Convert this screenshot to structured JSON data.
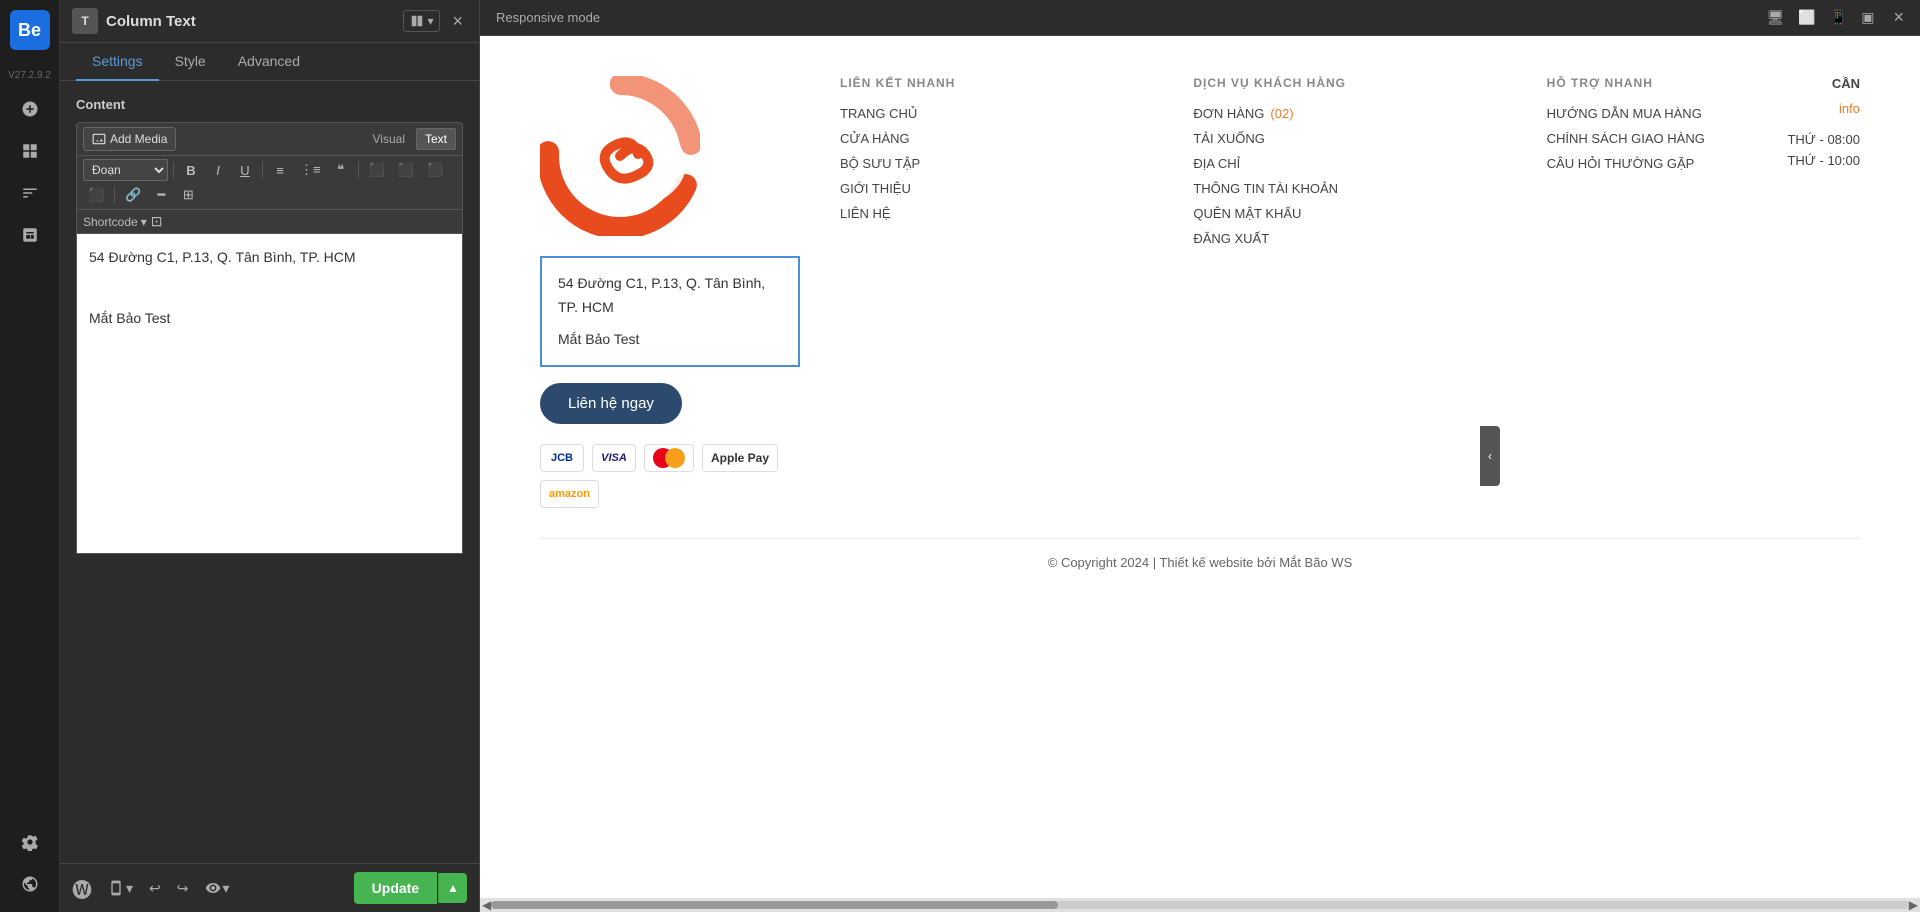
{
  "app": {
    "logo": "Be",
    "version": "V27.2.9.2"
  },
  "topbar": {
    "responsive_mode_label": "Responsive mode",
    "close_icon": "×"
  },
  "panel": {
    "title": "Column Text",
    "title_icon": "T",
    "tabs": [
      "Settings",
      "Style",
      "Advanced"
    ],
    "active_tab": "Settings",
    "section_label": "Content",
    "add_media_label": "Add Media",
    "visual_label": "Visual",
    "text_label": "Text",
    "format_options": [
      "Đoạn"
    ],
    "shortcode_label": "Shortcode",
    "editor_lines": [
      "54 Đường C1, P.13, Q. Tân Bình, TP. HCM",
      "",
      "Mắt Bảo Test"
    ]
  },
  "bottom_bar": {
    "update_label": "Update",
    "responsive_icon": "📱",
    "undo_icon": "↩",
    "redo_icon": "↪",
    "preview_icon": "👁"
  },
  "preview": {
    "logo_alt": "Mắt Bảo logo",
    "address_line1": "54 Đường C1, P.13, Q. Tân Bình,",
    "address_line2": "TP. HCM",
    "address_line3": "",
    "address_line4": "Mắt Bảo Test",
    "contact_button": "Liên hệ ngay",
    "payment_methods": [
      "JCB",
      "VISA",
      "MC",
      "Apple Pay",
      "amazon"
    ],
    "footer_nav": {
      "quick_links_title": "LIÊN KẾT NHANH",
      "quick_links": [
        "TRANG CHỦ",
        "CỬA HÀNG",
        "BỘ SƯU TẬP",
        "GIỚI THIỆU",
        "LIÊN HỆ"
      ],
      "customer_service_title": "DỊCH VỤ KHÁCH HÀNG",
      "customer_service": [
        {
          "label": "ĐƠN HÀNG",
          "badge": "(02)",
          "orange": true
        },
        "TẢI XUỐNG",
        "ĐỊA CHỈ",
        "THÔNG TIN TÀI KHOẢN",
        "QUÊN MẬT KHẨU",
        "ĐĂNG XUẤT"
      ],
      "support_title": "HỖ TRỢ NHANH",
      "support_links": [
        "HƯỚNG DẪN MUA HÀNG",
        "CHÍNH SÁCH GIAO HÀNG",
        "CÂU HỎI THƯỜNG GẶP"
      ],
      "can_label": "CẦN",
      "info_label": "info",
      "hours_1": "THỨ - 08:00",
      "hours_2": "THỨ - 10:00"
    },
    "copyright": "© Copyright 2024 | Thiết kế website bởi Mắt Bão WS"
  }
}
